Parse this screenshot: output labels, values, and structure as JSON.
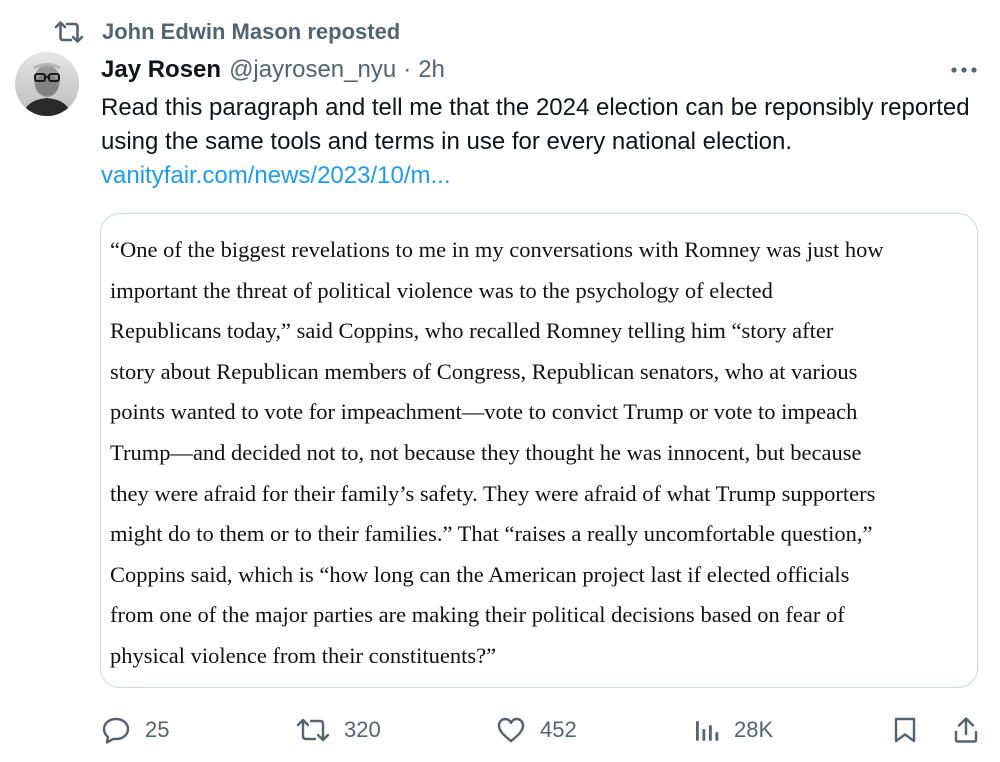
{
  "repost": {
    "icon": "repost-icon",
    "label": "John Edwin Mason reposted"
  },
  "author": {
    "avatar_icon": "avatar-photo",
    "display_name": "Jay Rosen",
    "handle": "@jayrosen_nyu",
    "separator": "·",
    "time": "2h"
  },
  "more_icon": "more-horizontal-icon",
  "tweet": {
    "text": "Read this paragraph and tell me that the 2024 election can be reponsibly reported using the same tools and terms in use for every national election.",
    "link": "vanityfair.com/news/2023/10/m..."
  },
  "quote": {
    "text": "“One of the biggest revelations to me in my conversations with Romney was just how\nimportant the threat of political violence was to the psychology of elected\nRepublicans today,” said Coppins, who recalled Romney telling him “story after\nstory about Republican members of Congress, Republican senators, who at various\npoints wanted to vote for impeachment—vote to convict Trump or vote to impeach\nTrump—and decided not to, not because they thought he was innocent, but because\nthey were afraid for their family’s safety. They were afraid of what Trump supporters\nmight do to them or to their families.” That “raises a really uncomfortable question,”\nCoppins said, which is “how long can the American project last if elected officials\nfrom one of the major parties are making their political decisions based on fear of\nphysical violence from their constituents?”"
  },
  "actions": {
    "reply": {
      "icon": "reply-icon",
      "count": "25"
    },
    "repost": {
      "icon": "repost-icon",
      "count": "320"
    },
    "like": {
      "icon": "heart-icon",
      "count": "452"
    },
    "views": {
      "icon": "views-icon",
      "count": "28K"
    },
    "bookmark": {
      "icon": "bookmark-icon"
    },
    "share": {
      "icon": "share-icon"
    }
  },
  "colors": {
    "text": "#0f1419",
    "secondary": "#536471",
    "link": "#1d9bf0",
    "border": "#cfd9de"
  }
}
